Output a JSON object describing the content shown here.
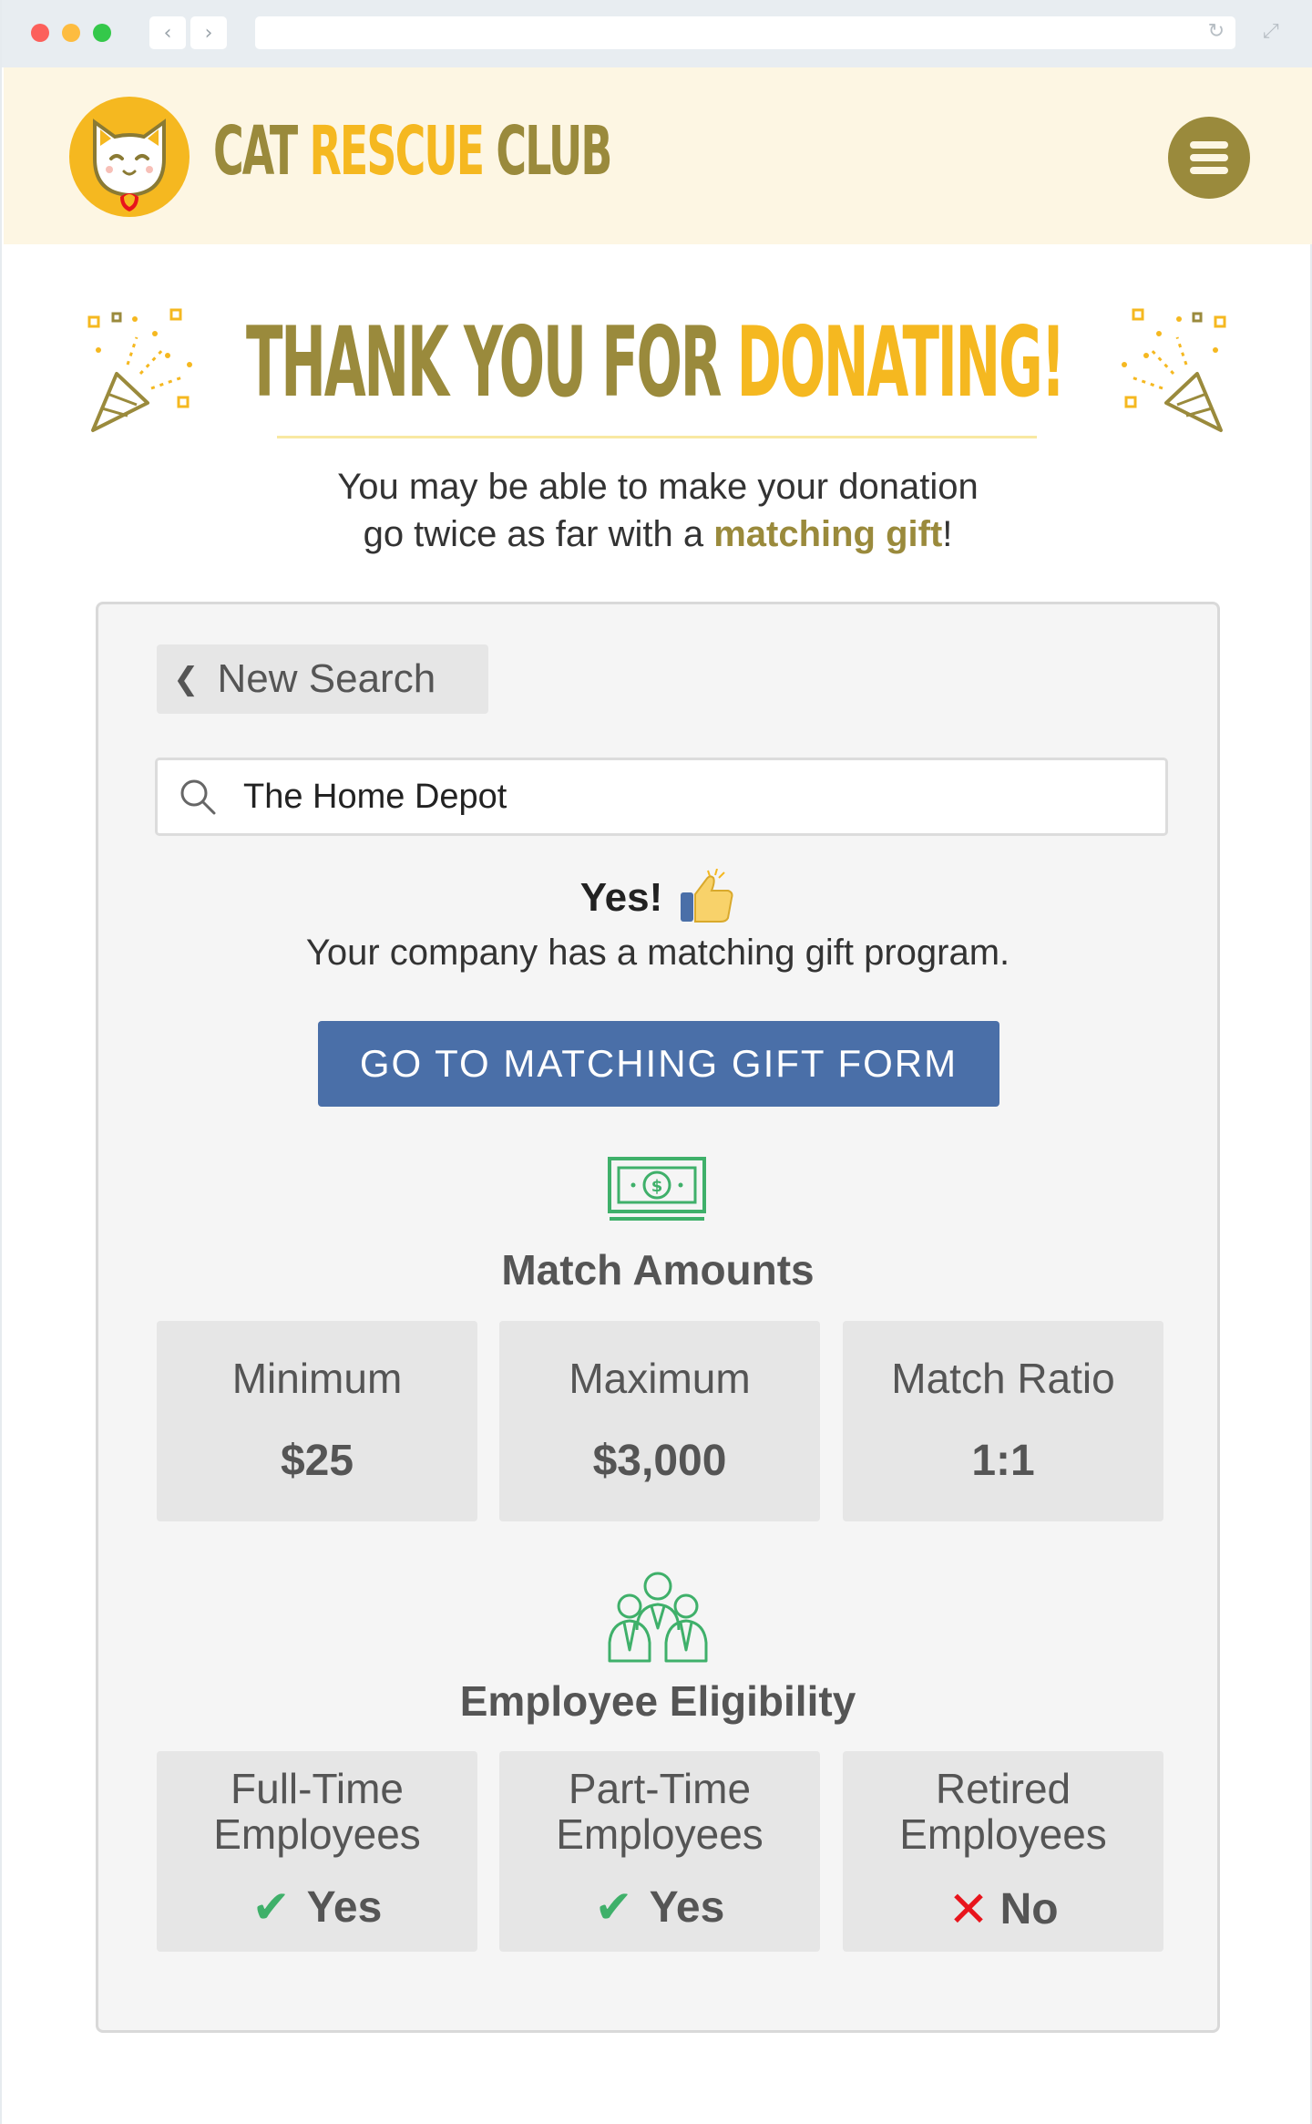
{
  "site": {
    "brand": {
      "part1": "CAT ",
      "part2": "RESCUE ",
      "part3": "CLUB"
    }
  },
  "hero": {
    "title_part1": "THANK YOU FOR ",
    "title_part2": "DONATING!",
    "subtitle_line1": "You may be able to make your donation",
    "subtitle_line2_prefix": "go twice as far with a ",
    "subtitle_highlight": "matching gift",
    "subtitle_suffix": "!"
  },
  "search": {
    "back_label": "New Search",
    "query": "The Home Depot"
  },
  "result": {
    "headline": "Yes!",
    "message": "Your company has a matching gift program.",
    "cta_label": "GO TO MATCHING GIFT FORM"
  },
  "match_amounts": {
    "title": "Match Amounts",
    "items": [
      {
        "label": "Minimum",
        "value": "$25"
      },
      {
        "label": "Maximum",
        "value": "$3,000"
      },
      {
        "label": "Match Ratio",
        "value": "1:1"
      }
    ]
  },
  "eligibility": {
    "title": "Employee Eligibility",
    "items": [
      {
        "label_line1": "Full-Time",
        "label_line2": "Employees",
        "value": "Yes",
        "status": "yes"
      },
      {
        "label_line1": "Part-Time",
        "label_line2": "Employees",
        "value": "Yes",
        "status": "yes"
      },
      {
        "label_line1": "Retired",
        "label_line2": "Employees",
        "value": "No",
        "status": "no"
      }
    ]
  },
  "colors": {
    "brand_olive": "#9a8a3c",
    "brand_gold": "#f5b820",
    "header_bg": "#fdf6e3",
    "button_blue": "#4a6fa8",
    "icon_green": "#3fb06a",
    "no_red": "#e8141c"
  }
}
